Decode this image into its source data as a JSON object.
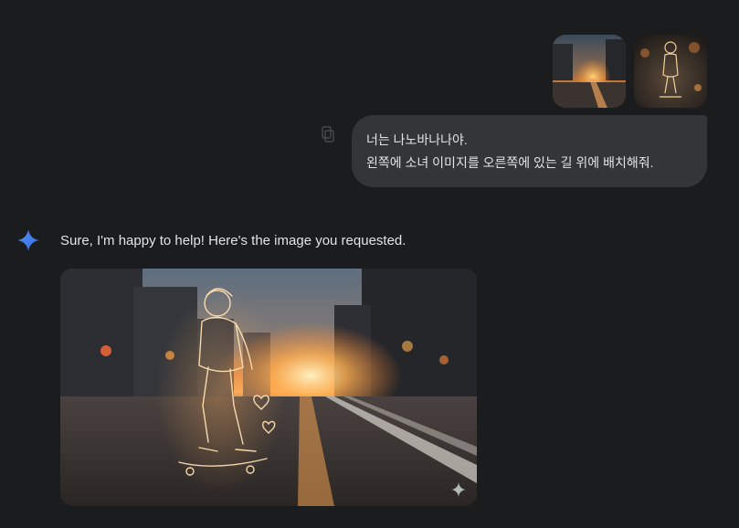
{
  "user_message": {
    "attachments": [
      {
        "name": "sunset-street-photo"
      },
      {
        "name": "neon-girl-drawing"
      }
    ],
    "lines": [
      "너는 나노바나나야.",
      "왼쪽에 소녀 이미지를 오른쪽에 있는 길 위에 배치해줘."
    ]
  },
  "assistant_message": {
    "text": "Sure, I'm happy to help! Here's the image you requested.",
    "image": {
      "subject": "neon-outline girl on skateboard on sunset street"
    }
  },
  "colors": {
    "background": "#1b1c1d",
    "bubble": "#333537",
    "text": "#e3e3e3",
    "spark_accent": "#4285f4"
  }
}
